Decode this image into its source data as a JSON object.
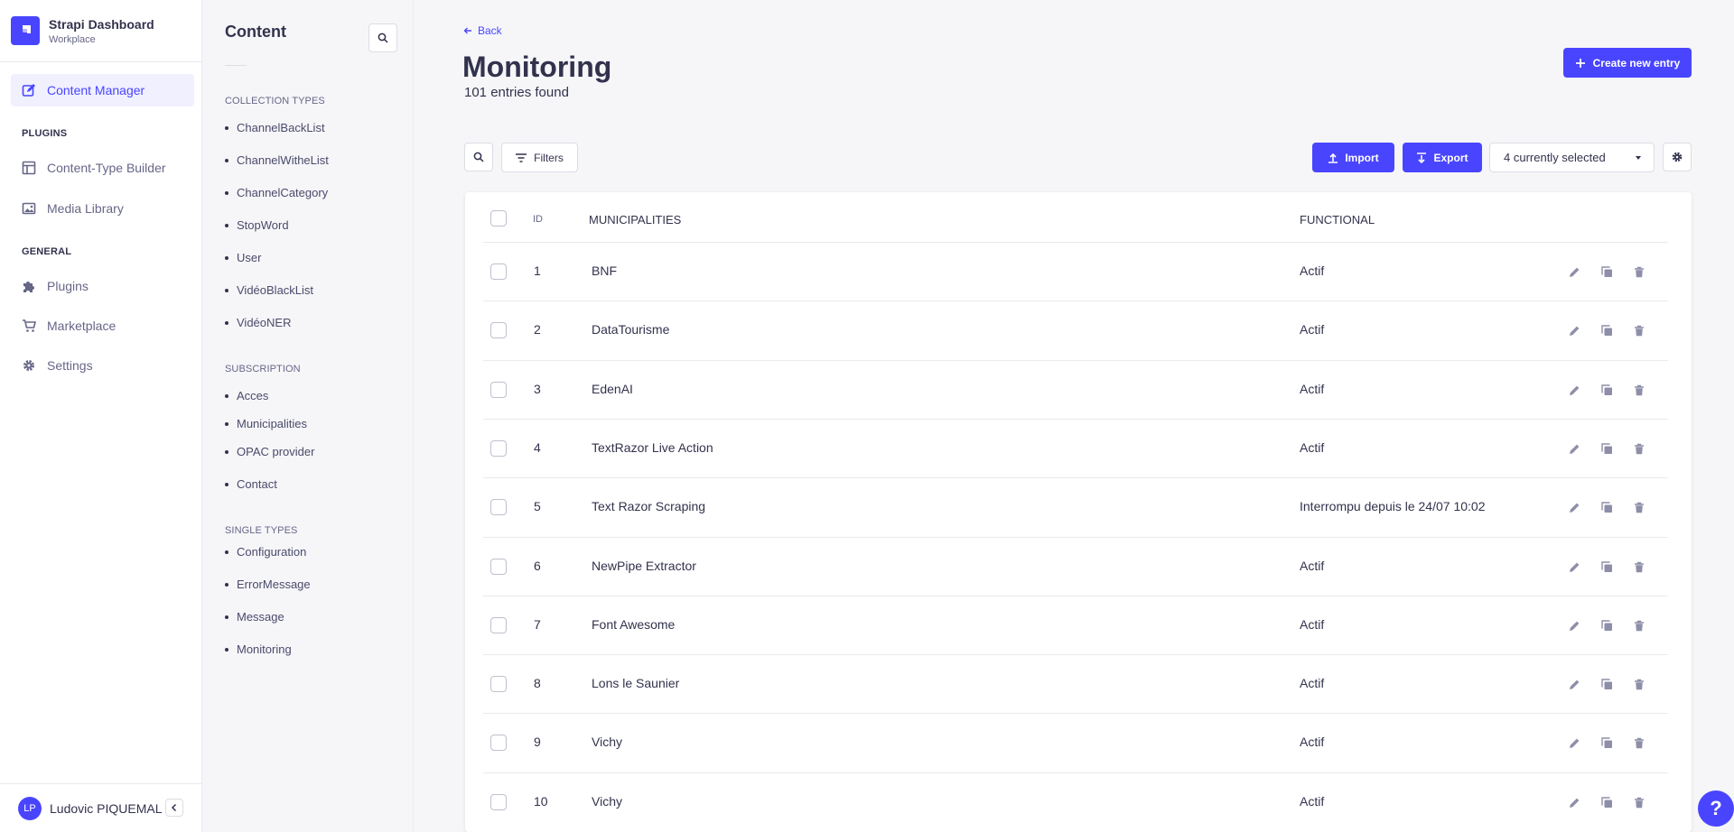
{
  "brand": {
    "title": "Strapi Dashboard",
    "subtitle": "Workplace"
  },
  "main_nav": {
    "content_manager": "Content Manager",
    "plugins_section": "PLUGINS",
    "content_type_builder": "Content-Type Builder",
    "media_library": "Media Library",
    "general_section": "GENERAL",
    "plugins": "Plugins",
    "marketplace": "Marketplace",
    "settings": "Settings"
  },
  "profile": {
    "initials": "LP",
    "name": "Ludovic PIQUEMAL"
  },
  "subnav": {
    "title": "Content",
    "collection_types_label": "COLLECTION TYPES",
    "collection_types": [
      "ChannelBackList",
      "ChannelWitheList",
      "ChannelCategory",
      "StopWord",
      "User",
      "VidéoBlackList",
      "VidéoNER"
    ],
    "subscription_label": "SUBSCRIPTION",
    "subscription": [
      "Acces",
      "Municipalities",
      "OPAC provider",
      "Contact"
    ],
    "single_types_label": "SINGLE TYPES",
    "single_types": [
      "Configuration",
      "ErrorMessage",
      "Message",
      "Monitoring"
    ]
  },
  "header": {
    "back": "Back",
    "title": "Monitoring",
    "entries_found": "101 entries found",
    "create_button": "Create new entry"
  },
  "toolbar": {
    "filters": "Filters",
    "import": "Import",
    "export": "Export",
    "columns_selected": "4 currently selected"
  },
  "table": {
    "columns": [
      "ID",
      "MUNICIPALITIES",
      "FUNCTIONAL"
    ],
    "rows": [
      {
        "id": "1",
        "municipality": "BNF",
        "functional": "Actif"
      },
      {
        "id": "2",
        "municipality": "DataTourisme",
        "functional": "Actif"
      },
      {
        "id": "3",
        "municipality": "EdenAI",
        "functional": "Actif"
      },
      {
        "id": "4",
        "municipality": "TextRazor Live Action",
        "functional": "Actif"
      },
      {
        "id": "5",
        "municipality": "Text Razor Scraping",
        "functional": "Interrompu depuis le 24/07  10:02"
      },
      {
        "id": "6",
        "municipality": "NewPipe Extractor",
        "functional": "Actif"
      },
      {
        "id": "7",
        "municipality": "Font Awesome",
        "functional": "Actif"
      },
      {
        "id": "8",
        "municipality": "Lons le Saunier",
        "functional": "Actif"
      },
      {
        "id": "9",
        "municipality": "Vichy",
        "functional": "Actif"
      },
      {
        "id": "10",
        "municipality": "Vichy",
        "functional": "Actif"
      }
    ]
  },
  "colors": {
    "primary": "#4945ff",
    "text": "#32324d",
    "muted": "#666687",
    "background": "#f6f6f9"
  },
  "help": "?"
}
